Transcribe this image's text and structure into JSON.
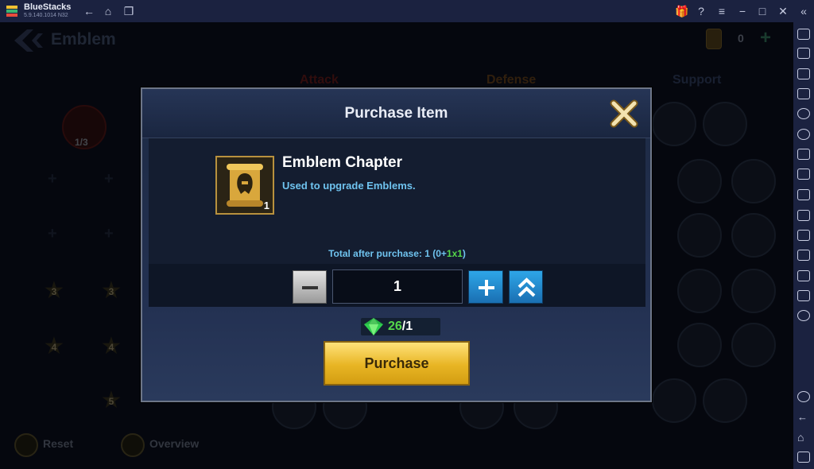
{
  "window": {
    "app_name": "BlueStacks",
    "version": "5.9.140.1014  N32"
  },
  "game": {
    "title": "Emblem",
    "currency_count": "0",
    "tabs": [
      "Attack",
      "Defense",
      "Support"
    ],
    "slot_counter": "1/3",
    "tier_labels": [
      "3",
      "3",
      "4",
      "4",
      "5"
    ],
    "bottom_buttons": {
      "reset": "Reset",
      "overview": "Overview"
    }
  },
  "modal": {
    "title": "Purchase Item",
    "item": {
      "name": "Emblem Chapter",
      "description": "Used to upgrade Emblems.",
      "owned_qty": "1"
    },
    "total_prefix": "Total after purchase: 1 (0+",
    "total_green": "1x1",
    "total_suffix": ")",
    "quantity": "1",
    "cost_have": "26",
    "cost_need": "/1",
    "purchase_label": "Purchase"
  },
  "colors": {
    "accent_blue": "#2ea6e8",
    "accent_gold": "#e8b524",
    "highlight_green": "#55d84a",
    "info_text": "#6fc3ef"
  }
}
